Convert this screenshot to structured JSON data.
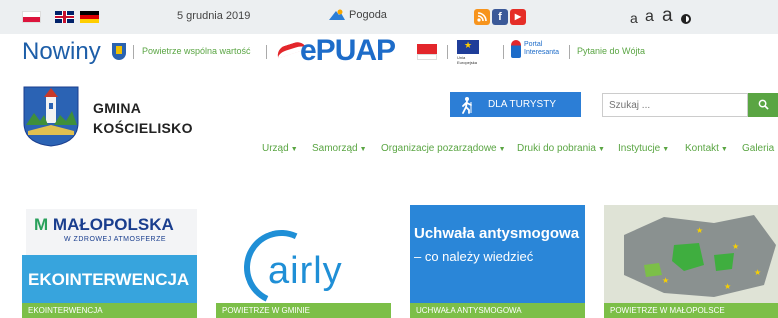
{
  "topbar": {
    "date": "5 grudnia 2019",
    "weather_label": "Pogoda",
    "languages": [
      "pl-flag-icon",
      "uk-flag-icon",
      "de-flag-icon"
    ],
    "social": {
      "rss": "rss-icon",
      "facebook_glyph": "f",
      "youtube_glyph": "▶"
    },
    "font_sizes": [
      "a",
      "a",
      "a"
    ],
    "contrast": "contrast-icon"
  },
  "strip": {
    "nowiny": "Nowiny",
    "powietrze_link": "Powietrze wspólna wartość",
    "epuap": "ePUAP",
    "eu_caption": "Unia Europejska",
    "portal_text": "Portal Interesanta",
    "pytanie_link": "Pytanie do Wójta"
  },
  "header": {
    "gmina_line1": "GMINA",
    "gmina_line2": "KOŚCIELISKO",
    "tourist_label": "DLA TURYSTY",
    "search_placeholder": "Szukaj ..."
  },
  "nav": [
    {
      "label": "Urząd",
      "dropdown": true
    },
    {
      "label": "Samorząd",
      "dropdown": true
    },
    {
      "label": "Organizacje pozarządowe",
      "dropdown": true
    },
    {
      "label": "Druki do pobrania",
      "dropdown": true
    },
    {
      "label": "Instytucje",
      "dropdown": true
    },
    {
      "label": "Kontakt",
      "dropdown": true
    },
    {
      "label": "Galeria",
      "dropdown": false
    }
  ],
  "tiles": [
    {
      "label": "EKOINTERWENCJA",
      "logo": "MAŁOPOLSKA",
      "logo_m": "M",
      "sub": "W ZDROWEJ ATMOSFERZE",
      "banner": "EKOINTERWENCJA"
    },
    {
      "label": "POWIETRZE W GMINIE",
      "logo": "airly"
    },
    {
      "label": "UCHWAŁA ANTYSMOGOWA",
      "head1": "Uchwała antysmogowa",
      "head2": "– co należy wiedzieć"
    },
    {
      "label": "POWIETRZE W MAŁOPOLSCE"
    }
  ],
  "colors": {
    "accent_green": "#5aa543",
    "tile_label_green": "#7cbf48",
    "tourist_blue": "#2c7ed6",
    "topbar_bg": "#eceff1"
  }
}
